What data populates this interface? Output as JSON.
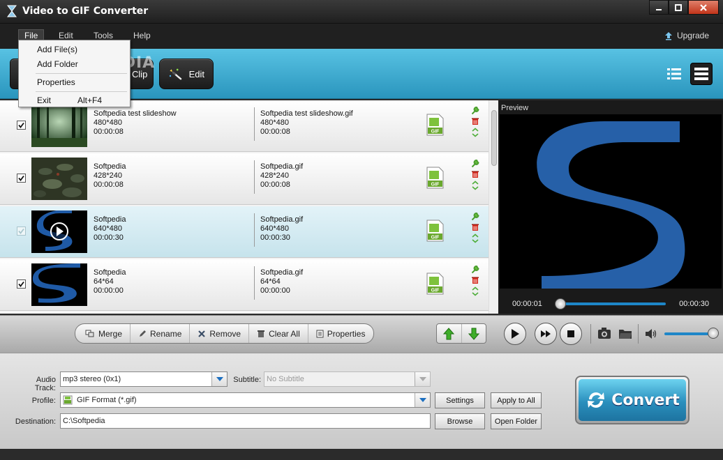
{
  "window": {
    "title": "Video to GIF Converter"
  },
  "menubar": {
    "items": [
      "File",
      "Edit",
      "Tools",
      "Help"
    ],
    "upgrade_label": "Upgrade"
  },
  "file_menu": {
    "items": [
      {
        "label": "Add File(s)",
        "shortcut": ""
      },
      {
        "label": "Add Folder",
        "shortcut": ""
      },
      {
        "label": "Properties",
        "shortcut": ""
      },
      {
        "label": "Exit",
        "shortcut": "Alt+F4"
      }
    ]
  },
  "toolbar": {
    "clip_label": "Clip",
    "edit_label": "Edit",
    "watermark": "SOFTPEDIA"
  },
  "files": [
    {
      "checked": true,
      "selected": false,
      "src_name": "Softpedia test slideshow",
      "src_res": "480*480",
      "src_dur": "00:00:08",
      "dst_name": "Softpedia test slideshow.gif",
      "dst_res": "480*480",
      "dst_dur": "00:00:08",
      "thumb": "forest"
    },
    {
      "checked": true,
      "selected": false,
      "src_name": "Softpedia",
      "src_res": "428*240",
      "src_dur": "00:00:08",
      "dst_name": "Softpedia.gif",
      "dst_res": "428*240",
      "dst_dur": "00:00:08",
      "thumb": "stones"
    },
    {
      "checked": true,
      "selected": true,
      "src_name": "Softpedia",
      "src_res": "640*480",
      "src_dur": "00:00:30",
      "dst_name": "Softpedia.gif",
      "dst_res": "640*480",
      "dst_dur": "00:00:30",
      "thumb": "logo-play"
    },
    {
      "checked": true,
      "selected": false,
      "src_name": "Softpedia",
      "src_res": "64*64",
      "src_dur": "00:00:00",
      "dst_name": "Softpedia.gif",
      "dst_res": "64*64",
      "dst_dur": "00:00:00",
      "thumb": "logo"
    }
  ],
  "list_actions": {
    "merge": "Merge",
    "rename": "Rename",
    "remove": "Remove",
    "clear_all": "Clear All",
    "properties": "Properties"
  },
  "preview": {
    "label": "Preview",
    "current_time": "00:00:01",
    "total_time": "00:00:30",
    "progress_fraction": 0.033,
    "volume_fraction": 1.0
  },
  "settings": {
    "audio_track_label": "Audio Track:",
    "audio_track_value": "mp3 stereo (0x1)",
    "subtitle_label": "Subtitle:",
    "subtitle_value": "No Subtitle",
    "profile_label": "Profile:",
    "profile_value": "GIF Format (*.gif)",
    "destination_label": "Destination:",
    "destination_value": "C:\\Softpedia",
    "settings_btn": "Settings",
    "apply_all_btn": "Apply to All",
    "browse_btn": "Browse",
    "open_folder_btn": "Open Folder"
  },
  "convert": {
    "label": "Convert"
  },
  "colors": {
    "accent": "#2a95bd",
    "dark": "#202020",
    "logo_blue": "#1f5aa6"
  },
  "icons": [
    "app-logo-icon",
    "minimize-icon",
    "maximize-icon",
    "close-icon",
    "upgrade-icon",
    "list-view-icon",
    "detail-view-icon",
    "wrench-icon",
    "trash-icon",
    "reorder-icon",
    "gif-file-icon",
    "merge-icon",
    "rename-icon",
    "remove-icon",
    "clear-icon",
    "properties-icon",
    "move-up-icon",
    "move-down-icon",
    "play-icon",
    "fast-forward-icon",
    "stop-icon",
    "snapshot-icon",
    "folder-icon",
    "volume-icon",
    "refresh-icon"
  ]
}
